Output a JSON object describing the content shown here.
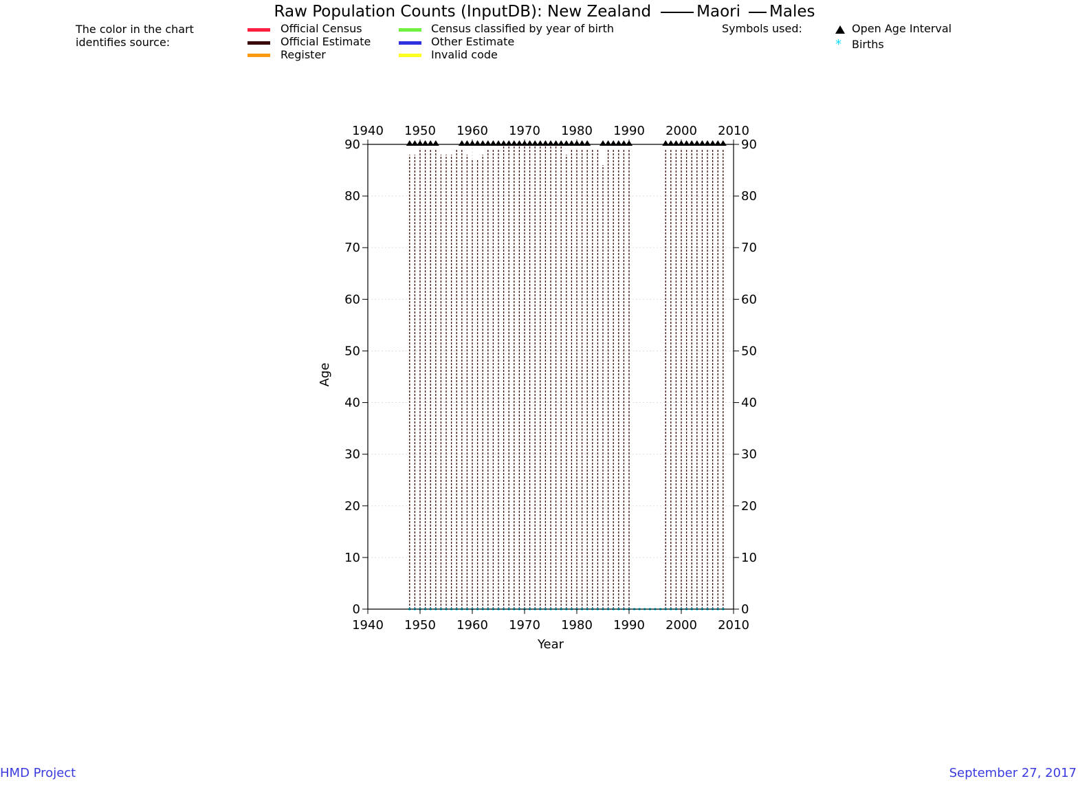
{
  "title": {
    "main": "Raw Population Counts (InputDB): New Zealand",
    "group": "Maori",
    "sex": "Males"
  },
  "legend_source": {
    "intro_line1": "The color in the chart",
    "intro_line2": "identifies source:",
    "items": [
      {
        "label": "Official Census",
        "color": "#ff2040"
      },
      {
        "label": "Official Estimate",
        "color": "#3a0a0a"
      },
      {
        "label": "Register",
        "color": "#ff9a10"
      },
      {
        "label": "Census classified by year of birth",
        "color": "#70f040"
      },
      {
        "label": "Other Estimate",
        "color": "#3030e0"
      },
      {
        "label": "Invalid code",
        "color": "#ffff20"
      }
    ]
  },
  "legend_symbols": {
    "heading": "Symbols used:",
    "items": [
      {
        "label": "Open Age Interval",
        "icon": "triangle-icon",
        "color": "#000000"
      },
      {
        "label": "Births",
        "icon": "asterisk-icon",
        "color": "#00e0ff"
      }
    ]
  },
  "chart_data": {
    "type": "scatter",
    "xlabel": "Year",
    "ylabel": "Age",
    "xlim": [
      1940,
      2010
    ],
    "ylim": [
      0,
      90
    ],
    "x_ticks": [
      1940,
      1950,
      1960,
      1970,
      1980,
      1990,
      2000,
      2010
    ],
    "y_ticks": [
      0,
      10,
      20,
      30,
      40,
      50,
      60,
      70,
      80,
      90
    ],
    "grid": true,
    "series": [
      {
        "name": "Official Estimate",
        "color": "#3a0a0a",
        "years": [
          1948,
          1949,
          1950,
          1951,
          1952,
          1953,
          1954,
          1955,
          1956,
          1957,
          1958,
          1959,
          1960,
          1961,
          1962,
          1963,
          1964,
          1965,
          1966,
          1967,
          1968,
          1969,
          1970,
          1971,
          1972,
          1973,
          1974,
          1975,
          1976,
          1977,
          1978,
          1979,
          1980,
          1981,
          1982,
          1983,
          1984,
          1985,
          1986,
          1987,
          1988,
          1989,
          1990,
          1997,
          1998,
          1999,
          2000,
          2001,
          2002,
          2003,
          2004,
          2005,
          2006,
          2007,
          2008
        ],
        "max_age": [
          88,
          88,
          89,
          89,
          89,
          89,
          88,
          88,
          88,
          89,
          89,
          88,
          87,
          87,
          88,
          89,
          89,
          89,
          90,
          90,
          90,
          90,
          90,
          90,
          90,
          90,
          90,
          90,
          90,
          90,
          88,
          89,
          89,
          89,
          89,
          89,
          89,
          86,
          89,
          89,
          89,
          89,
          89,
          89,
          89,
          89,
          89,
          89,
          89,
          89,
          89,
          89,
          89,
          89,
          89
        ],
        "open_age_interval": [
          90,
          90,
          90,
          90,
          90,
          90,
          null,
          null,
          null,
          null,
          90,
          90,
          90,
          90,
          90,
          90,
          90,
          90,
          90,
          90,
          90,
          90,
          90,
          90,
          90,
          90,
          90,
          90,
          90,
          90,
          90,
          90,
          90,
          90,
          90,
          null,
          null,
          90,
          90,
          90,
          90,
          90,
          90,
          90,
          90,
          90,
          90,
          90,
          90,
          90,
          90,
          90,
          90,
          90,
          90
        ]
      },
      {
        "name": "Births",
        "color": "#00e0ff",
        "years": [
          1948,
          1949,
          1950,
          1951,
          1952,
          1953,
          1954,
          1955,
          1956,
          1957,
          1958,
          1959,
          1960,
          1961,
          1962,
          1963,
          1964,
          1965,
          1966,
          1967,
          1968,
          1969,
          1970,
          1971,
          1972,
          1973,
          1974,
          1975,
          1976,
          1977,
          1978,
          1979,
          1980,
          1981,
          1982,
          1983,
          1984,
          1985,
          1986,
          1987,
          1988,
          1989,
          1990,
          1991,
          1992,
          1993,
          1994,
          1995,
          1996,
          1997,
          1998,
          1999,
          2000,
          2001,
          2002,
          2003,
          2004,
          2005,
          2006,
          2007,
          2008
        ],
        "age": 0
      }
    ]
  },
  "footer": {
    "left": "HMD Project",
    "right": "September 27, 2017"
  }
}
